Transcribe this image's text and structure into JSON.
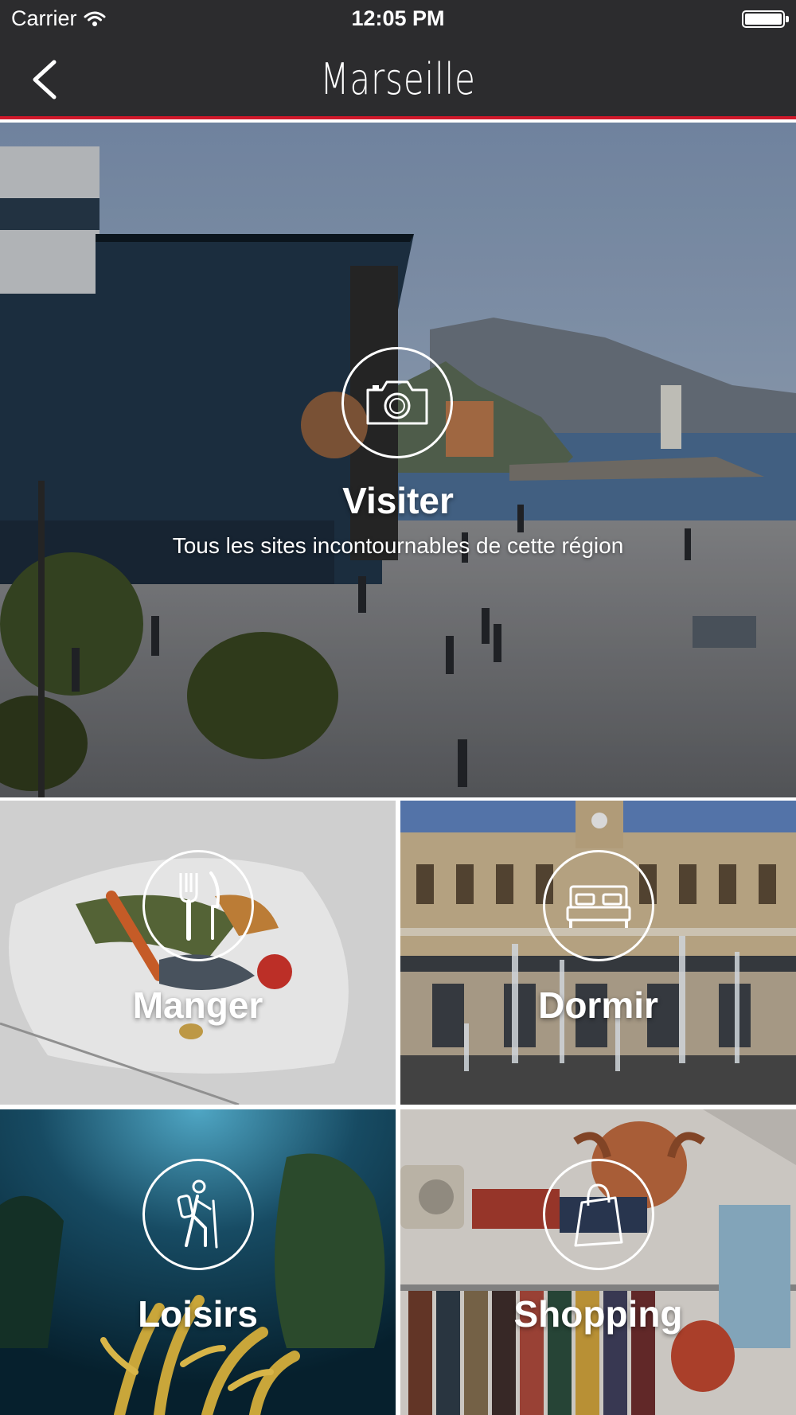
{
  "status_bar": {
    "carrier": "Carrier",
    "time": "12:05 PM",
    "wifi_icon": "wifi-icon",
    "battery_icon": "battery-icon"
  },
  "nav": {
    "title": "Marseille",
    "back_icon": "chevron-left-icon"
  },
  "hero": {
    "title": "Visiter",
    "subtitle": "Tous les sites incontournables de cette région",
    "icon": "camera-icon"
  },
  "tiles": [
    {
      "label": "Manger",
      "icon": "fork-knife-icon"
    },
    {
      "label": "Dormir",
      "icon": "bed-icon"
    },
    {
      "label": "Loisirs",
      "icon": "hiker-icon"
    },
    {
      "label": "Shopping",
      "icon": "shopping-bag-icon"
    }
  ],
  "colors": {
    "bar_background": "#2c2c2e",
    "accent_red": "#d0182a",
    "text": "#ffffff"
  }
}
